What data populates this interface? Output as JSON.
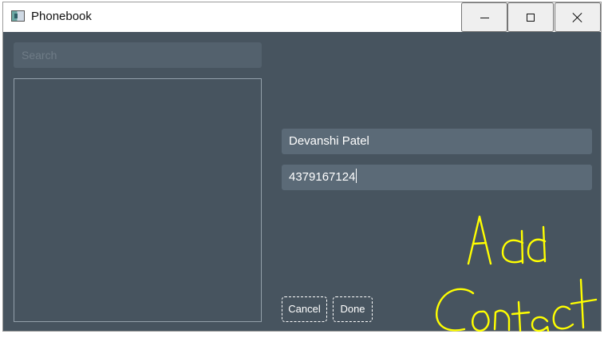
{
  "window": {
    "title": "Phonebook",
    "controls": {
      "minimize": "minimize",
      "maximize": "maximize",
      "close": "close"
    }
  },
  "left_panel": {
    "search_placeholder": "Search",
    "contacts": []
  },
  "form": {
    "name_value": "Devanshi Patel",
    "phone_value": "4379167124",
    "cancel_label": "Cancel",
    "done_label": "Done"
  },
  "annotation": {
    "text": "Add Contact",
    "color": "#ffff00"
  },
  "colors": {
    "client_background": "#47545f",
    "input_background": "#5b6a77",
    "search_background": "#53616d",
    "list_border": "#93a0aa"
  },
  "icons": {
    "app_icon": "window-app-icon",
    "minimize": "minimize-icon",
    "maximize": "maximize-icon",
    "close": "close-icon"
  }
}
